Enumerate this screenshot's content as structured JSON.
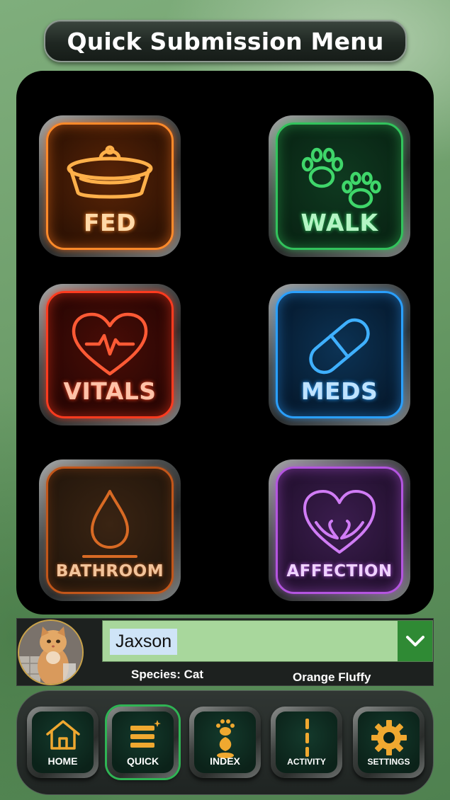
{
  "header": {
    "title": "Quick Submission Menu"
  },
  "tiles": [
    {
      "key": "fed",
      "label": "FED",
      "icon": "food-bowl-icon",
      "color": "#ff8a2a"
    },
    {
      "key": "walk",
      "label": "WALK",
      "icon": "paw-prints-icon",
      "color": "#32c35c"
    },
    {
      "key": "vitals",
      "label": "VITALS",
      "icon": "heartbeat-icon",
      "color": "#ff3b1f"
    },
    {
      "key": "meds",
      "label": "MEDS",
      "icon": "pill-icon",
      "color": "#2aa0ff"
    },
    {
      "key": "bathroom",
      "label": "BATHROOM",
      "icon": "water-drop-icon",
      "color": "#c2561a"
    },
    {
      "key": "affection",
      "label": "AFFECTION",
      "icon": "heart-hands-icon",
      "color": "#b455e0"
    }
  ],
  "pet": {
    "name": "Jaxson",
    "species": "Species: Cat",
    "description": "Orange Fluffy",
    "dropdown_icon": "chevron-down-icon"
  },
  "nav": [
    {
      "label": "HOME",
      "icon": "house-icon",
      "active": false
    },
    {
      "label": "QUICK",
      "icon": "quick-list-icon",
      "active": true
    },
    {
      "label": "INDEX",
      "icon": "paw-leaf-icon",
      "active": false
    },
    {
      "label": "ACTIVITY",
      "icon": "activity-icon",
      "active": false
    },
    {
      "label": "SETTINGS",
      "icon": "gear-icon",
      "active": false
    }
  ]
}
